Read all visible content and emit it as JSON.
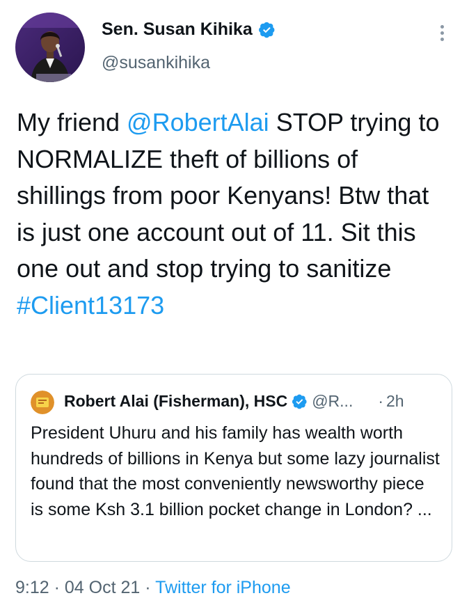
{
  "author": {
    "name": "Sen. Susan Kihika",
    "handle": "@susankihika",
    "avatar_icon": "user-avatar"
  },
  "tweet": {
    "text_before": "My friend ",
    "mention": "@RobertAlai",
    "text_after": " STOP trying to NORMALIZE theft of billions of shillings from poor Kenyans! Btw that is just one account out of 11. Sit this one out and stop trying to sanitize ",
    "hashtag": "#Client13173"
  },
  "quoted_tweet": {
    "name": "Robert Alai (Fisherman), HSC",
    "handle": "@R...",
    "separator": "·",
    "time": "2h",
    "text": "President Uhuru and his family has wealth worth hundreds of billions in Kenya but some lazy journalist found that the most conveniently newsworthy piece is some Ksh 3.1 billion pocket change in London? ..."
  },
  "footer": {
    "time": "9:12",
    "sep1": " · ",
    "date": "04 Oct 21",
    "sep2": " · ",
    "source": "Twitter for iPhone"
  },
  "colors": {
    "link": "#1d9bf0",
    "verified": "#1d9bf0",
    "secondary_text": "#536471",
    "border": "#cfd9de"
  }
}
